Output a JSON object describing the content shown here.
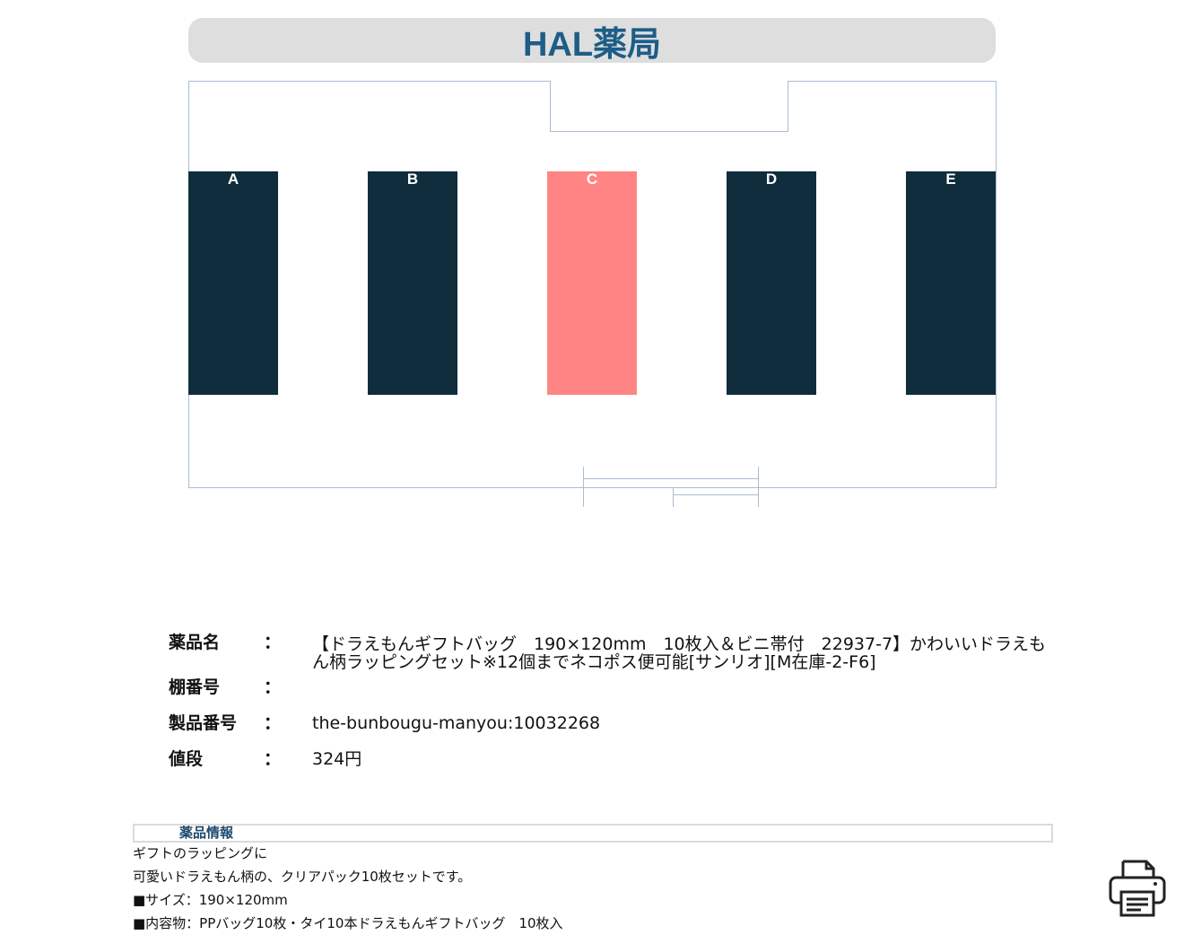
{
  "header": {
    "title": "HAL薬局"
  },
  "floor_map": {
    "shelves": [
      {
        "label": "A",
        "active": false
      },
      {
        "label": "B",
        "active": false
      },
      {
        "label": "C",
        "active": true
      },
      {
        "label": "D",
        "active": false
      },
      {
        "label": "E",
        "active": false
      }
    ],
    "colors": {
      "shelf": "#0f2d3d",
      "shelf_active": "#ff8585",
      "border": "#a9bdd1"
    }
  },
  "product": {
    "name_label": "薬品名",
    "name_value": "【ドラえもんギフトバッグ　190×120mm　10枚入＆ビニ帯付　22937-7】かわいいドラえもん柄ラッピングセット※12個までネコポス便可能[サンリオ][M在庫-2-F6]",
    "shelf_label": "棚番号",
    "shelf_value": "",
    "code_label": "製品番号",
    "code_value": "the-bunbougu-manyou:10032268",
    "price_label": "値段",
    "price_value": "324円",
    "colon": "："
  },
  "details": {
    "title": "薬品情報",
    "lines": [
      "ギフトのラッピングに",
      "可愛いドラえもん柄の、クリアパック10枚セットです。",
      "■サイズ：190×120mm",
      "■内容物：PPバッグ10枚・タイ10本ドラえもんギフトバッグ　10枚入"
    ]
  },
  "actions": {
    "print_icon": "printer-icon"
  }
}
